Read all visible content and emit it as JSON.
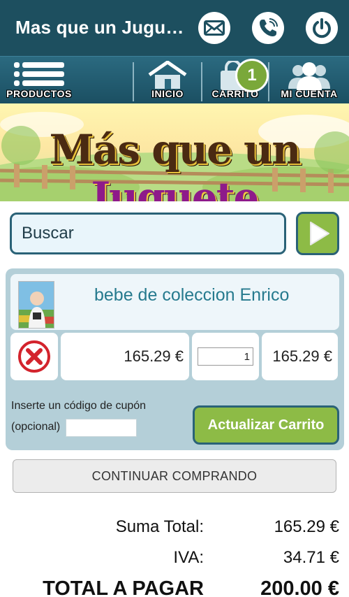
{
  "app": {
    "title": "Mas que un Jugu…"
  },
  "header_actions": [
    {
      "name": "email",
      "icon": "email-icon"
    },
    {
      "name": "phone",
      "icon": "phone-icon"
    },
    {
      "name": "power",
      "icon": "power-icon"
    }
  ],
  "nav": {
    "productos": "PRODUCTOS",
    "inicio": "INICIO",
    "carrito": "CARRITO",
    "mi_cuenta": "MI CUENTA",
    "cart_count": "1"
  },
  "banner": {
    "word1": "Más que un",
    "word2": "Juguete"
  },
  "search": {
    "placeholder": "Buscar"
  },
  "cart": {
    "item": {
      "name": "bebe de coleccion Enrico",
      "unit_price": "165.29 €",
      "quantity": "1",
      "line_total": "165.29 €"
    },
    "coupon_label_line1": "Inserte un código de cupón",
    "coupon_label_line2": "(opcional)",
    "update_button": "Actualizar Carrito"
  },
  "continue_button": "CONTINUAR COMPRANDO",
  "totals": {
    "subtotal_label": "Suma Total:",
    "subtotal_value": "165.29 €",
    "tax_label": "IVA:",
    "tax_value": "34.71 €",
    "grand_label": "TOTAL A PAGAR",
    "grand_value": "200.00 €"
  },
  "colors": {
    "header": "#1d4f5f",
    "accent_green": "#8dbb46",
    "panel": "#b4cfd8",
    "link_text": "#267a8e"
  }
}
